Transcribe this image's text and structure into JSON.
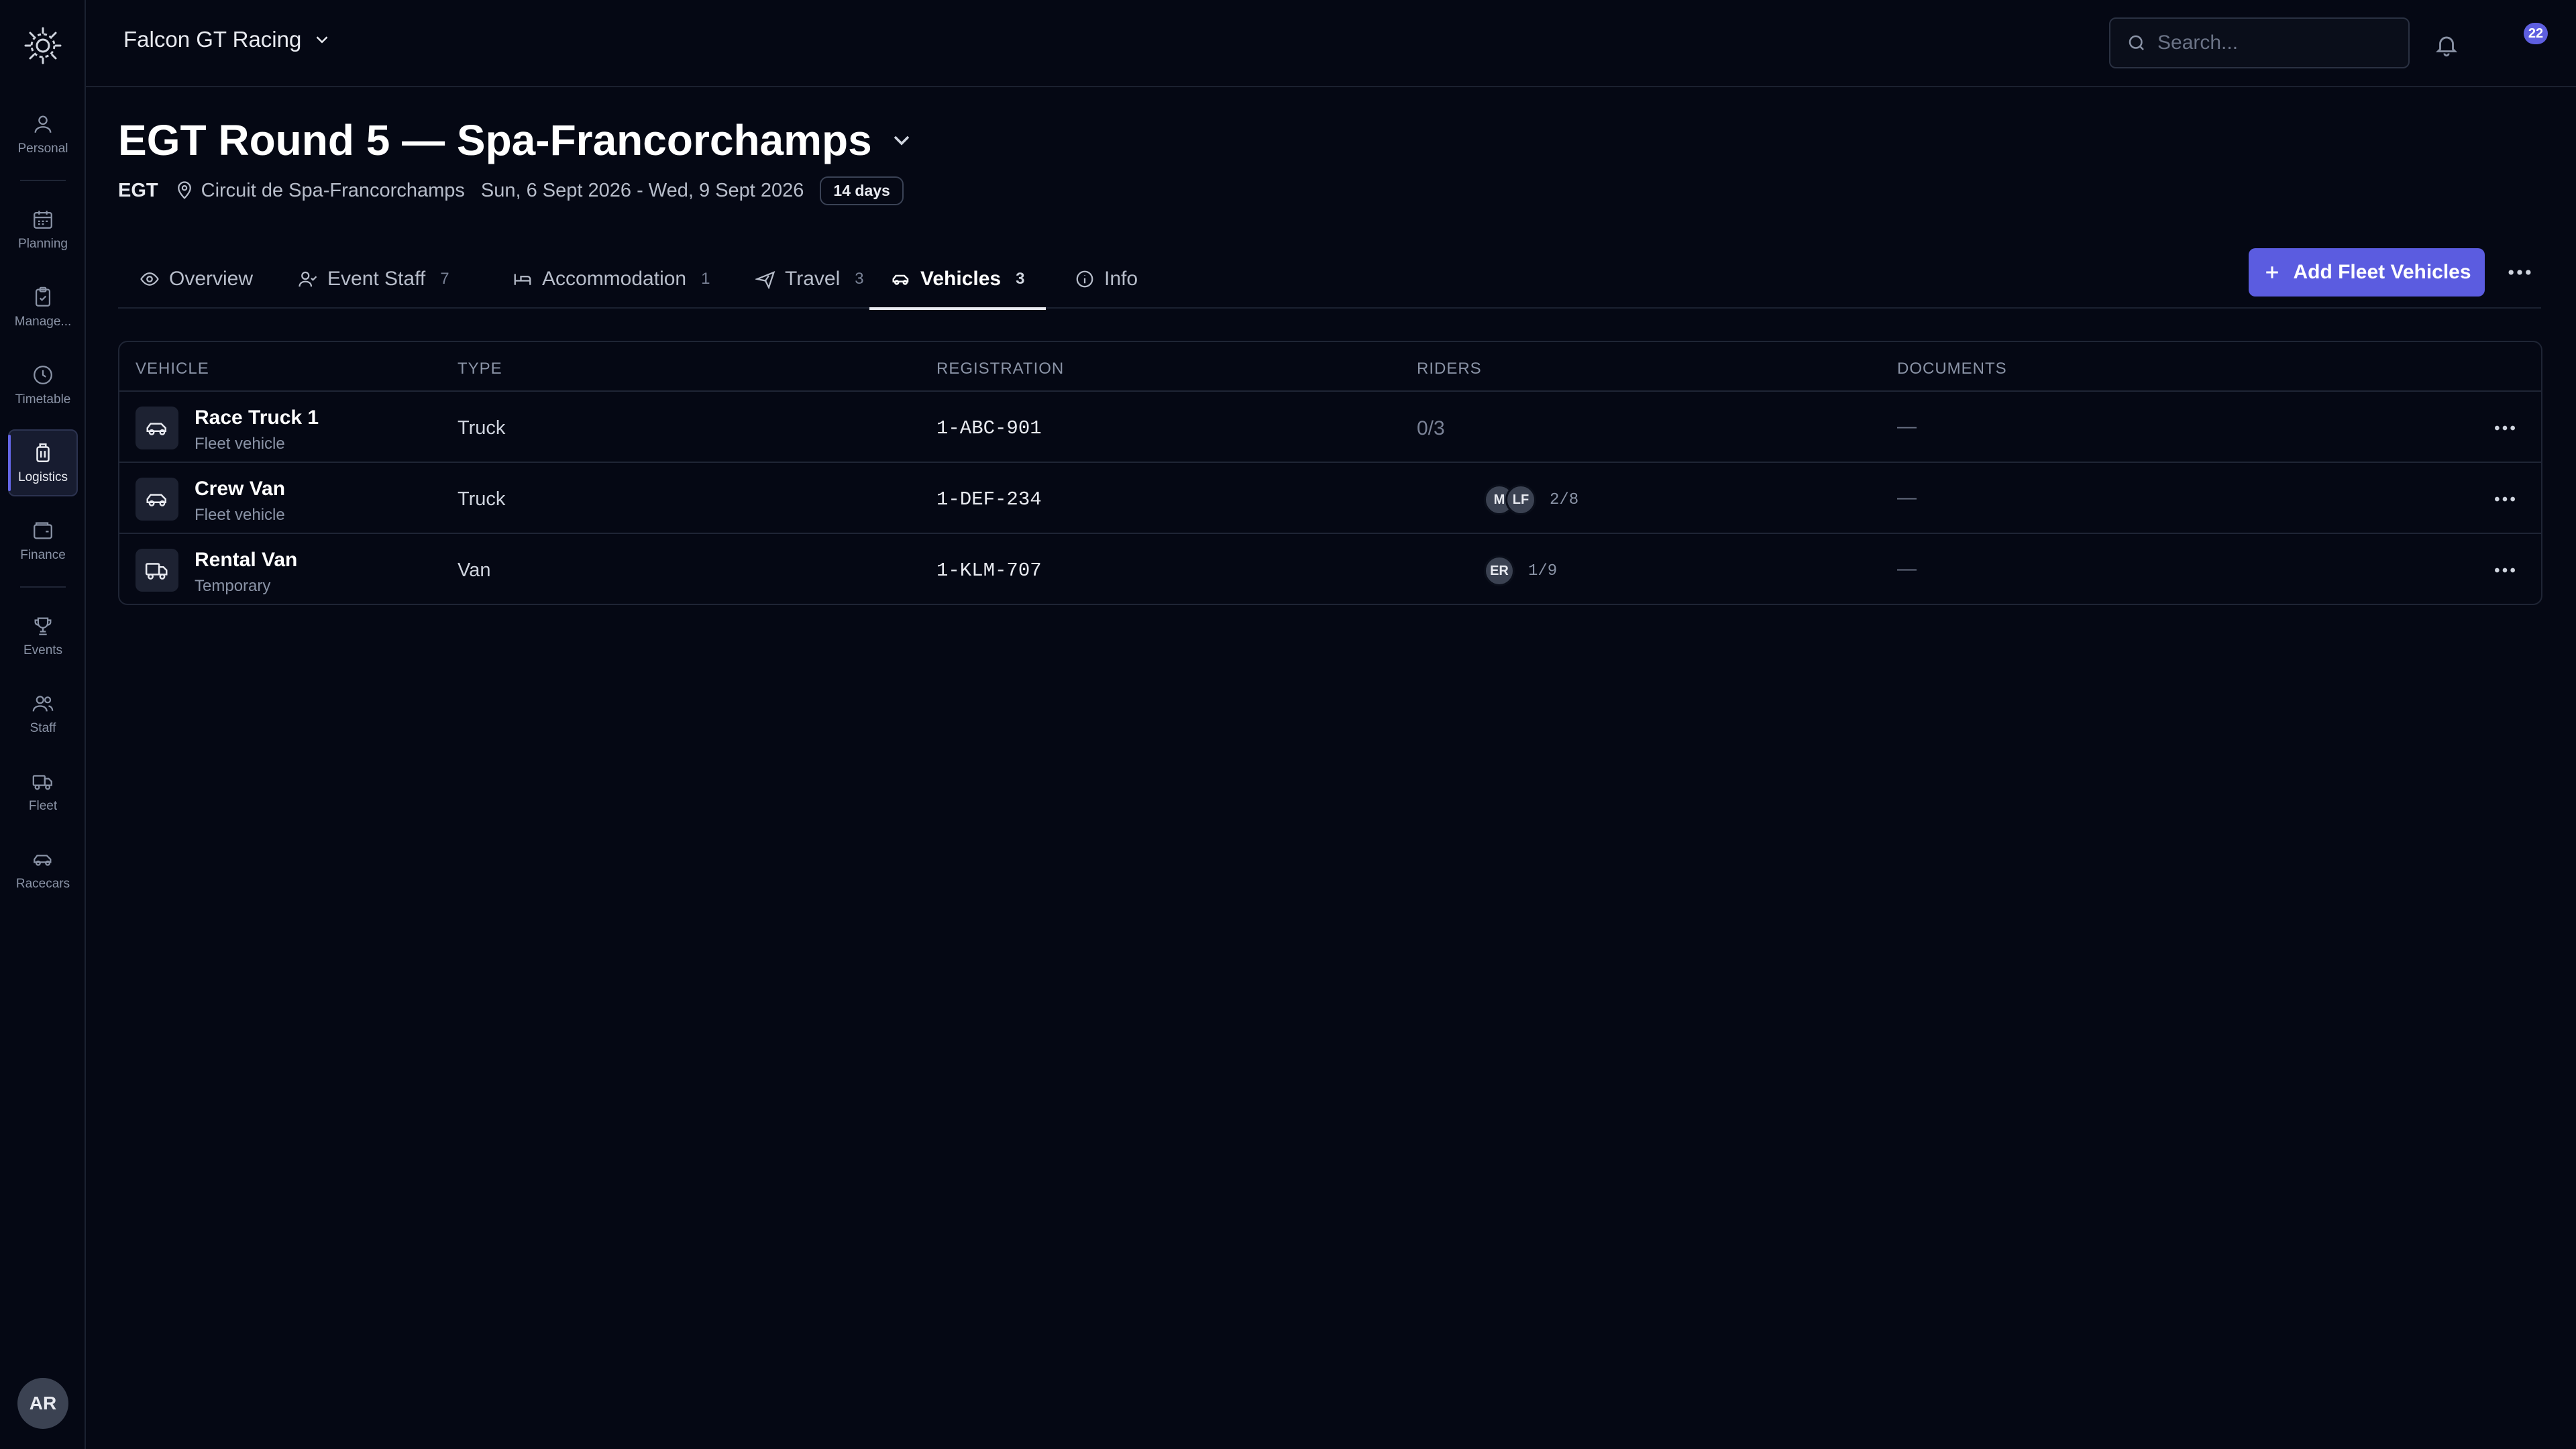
{
  "nav": {
    "items": [
      {
        "label": "Personal",
        "icon": "user-icon"
      },
      {
        "label": "Planning",
        "icon": "calendar-icon"
      },
      {
        "label": "Manage...",
        "icon": "clipboard-icon"
      },
      {
        "label": "Timetable",
        "icon": "clock-icon"
      },
      {
        "label": "Logistics",
        "icon": "luggage-icon"
      },
      {
        "label": "Finance",
        "icon": "wallet-icon"
      },
      {
        "label": "Events",
        "icon": "trophy-icon"
      },
      {
        "label": "Staff",
        "icon": "users-icon"
      },
      {
        "label": "Fleet",
        "icon": "truck-icon"
      },
      {
        "label": "Racecars",
        "icon": "car-icon"
      }
    ],
    "active": "Logistics",
    "user_initials": "AR"
  },
  "topbar": {
    "org_name": "Falcon GT Racing",
    "search_placeholder": "Search...",
    "notification_count": "22"
  },
  "event": {
    "title": "EGT Round 5 — Spa-Francorchamps",
    "series": "EGT",
    "location": "Circuit de Spa-Francorchamps",
    "dates": "Sun, 6 Sept 2026 - Wed, 9 Sept 2026",
    "duration": "14 days"
  },
  "tabs": [
    {
      "label": "Overview",
      "count": ""
    },
    {
      "label": "Event Staff",
      "count": "7"
    },
    {
      "label": "Accommodation",
      "count": "1"
    },
    {
      "label": "Travel",
      "count": "3"
    },
    {
      "label": "Vehicles",
      "count": "3"
    },
    {
      "label": "Info",
      "count": ""
    }
  ],
  "active_tab": "Vehicles",
  "actions": {
    "add_label": "Add Fleet Vehicles"
  },
  "table": {
    "columns": [
      "VEHICLE",
      "TYPE",
      "REGISTRATION",
      "RIDERS",
      "DOCUMENTS"
    ],
    "rows": [
      {
        "name": "Race Truck 1",
        "sub": "Fleet vehicle",
        "type": "Truck",
        "registration": "1-ABC-901",
        "riders_empty": "0/3",
        "riders": [],
        "rider_count": "",
        "documents": "—"
      },
      {
        "name": "Crew Van",
        "sub": "Fleet vehicle",
        "type": "Truck",
        "registration": "1-DEF-234",
        "riders_empty": "",
        "riders": [
          "M",
          "LF"
        ],
        "rider_count": "2/8",
        "documents": "—"
      },
      {
        "name": "Rental Van",
        "sub": "Temporary",
        "type": "Van",
        "registration": "1-KLM-707",
        "riders_empty": "",
        "riders": [
          "ER"
        ],
        "rider_count": "1/9",
        "documents": "—"
      }
    ]
  },
  "colors": {
    "background": "#050814",
    "accent": "#5b5ce0",
    "border": "#1f2535"
  }
}
